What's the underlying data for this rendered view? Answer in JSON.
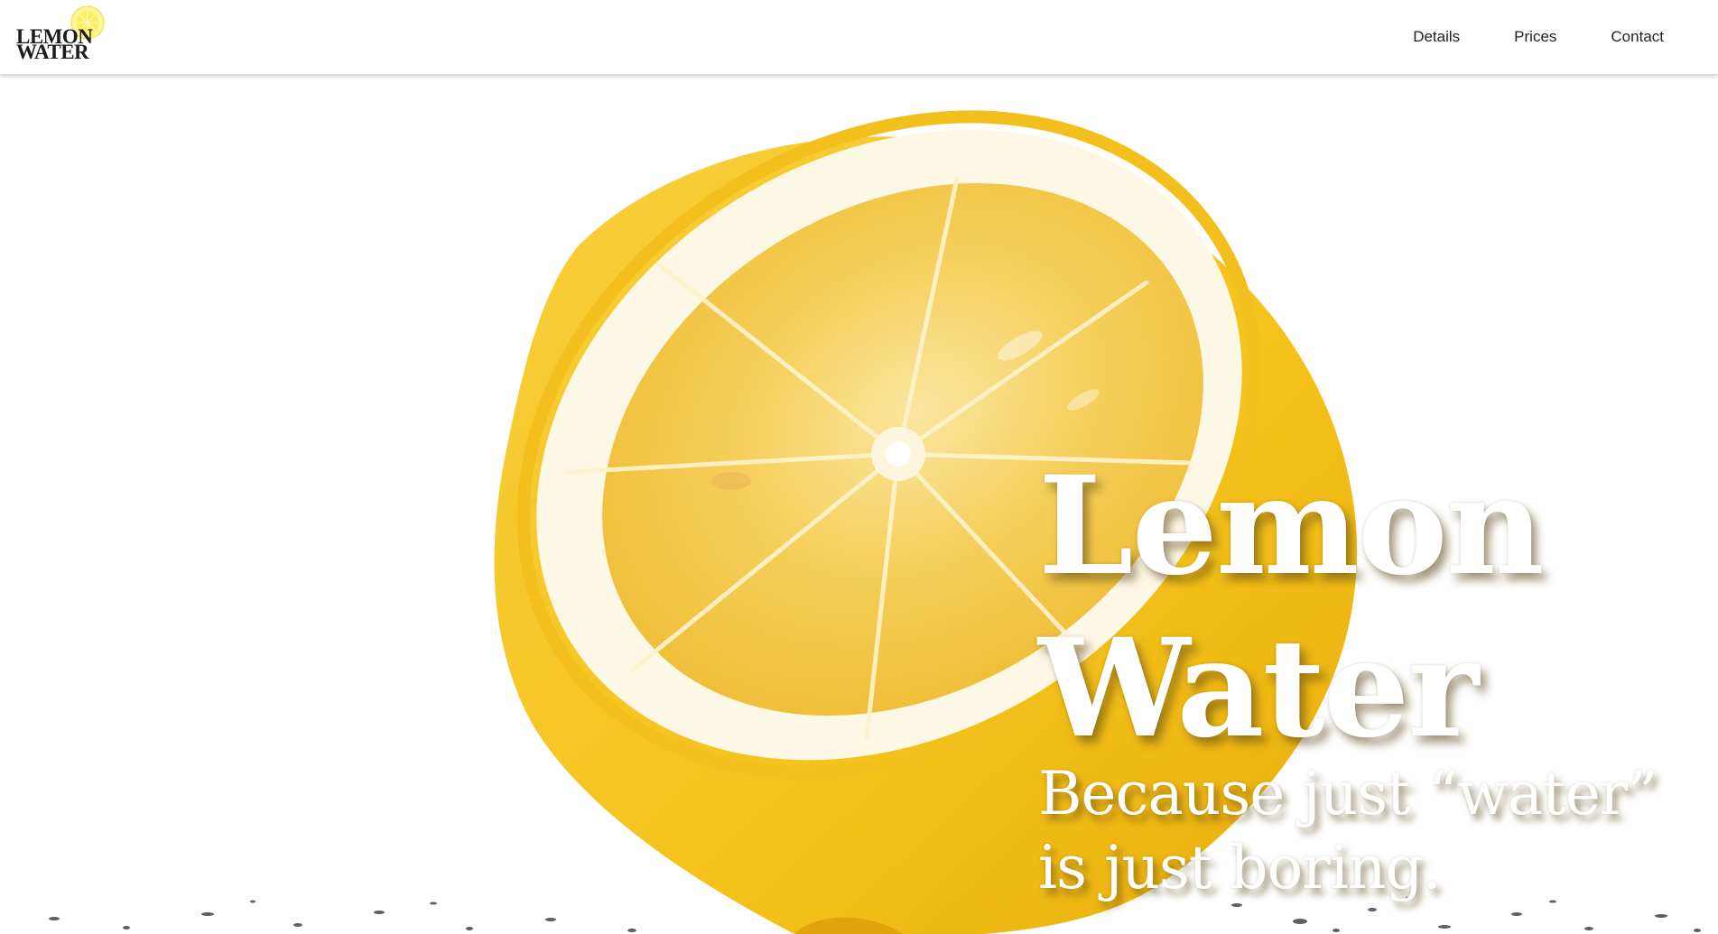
{
  "logo": {
    "line1": "Lemon",
    "line2": "Water",
    "icon": "lemon-slice-icon"
  },
  "nav": {
    "items": [
      {
        "label": "Details"
      },
      {
        "label": "Prices"
      },
      {
        "label": "Contact"
      }
    ]
  },
  "hero": {
    "title": "Lemon Water",
    "subtitle": "Because just “water” is just boring.",
    "image": "halved-lemon-photo"
  },
  "colors": {
    "lemon_yellow": "#f6c21a",
    "lemon_flesh": "#f3cd5a",
    "rind_white": "#fdf8e6",
    "header_bg": "#ffffff",
    "nav_text": "#222222"
  }
}
